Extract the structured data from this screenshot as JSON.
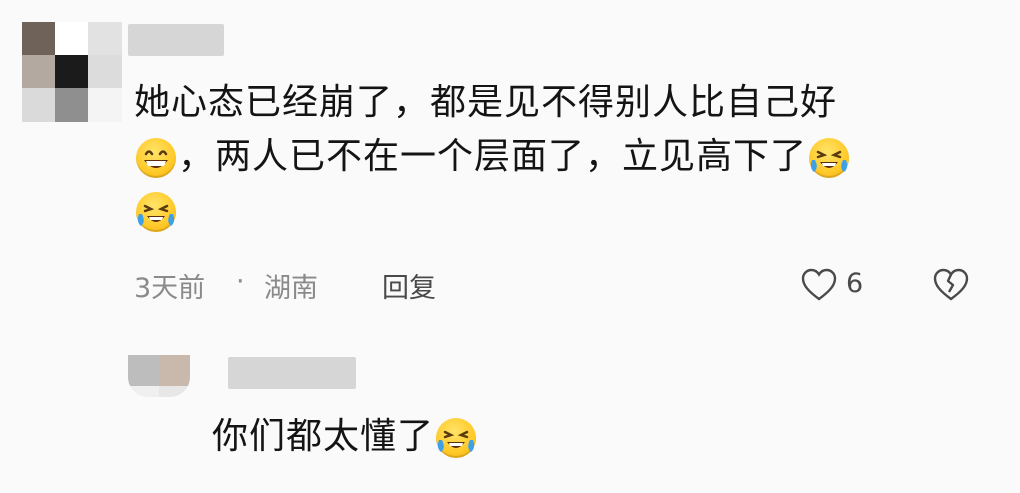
{
  "comment": {
    "lines": [
      "她心态已经崩了，都是见不得别人比自己好",
      "，两人已不在一个层面了，立见高下了"
    ],
    "emojis": [
      "grin-emoji",
      "rofl-emoji",
      "rofl-emoji"
    ],
    "time": "3天前",
    "separator": "·",
    "location": "湖南",
    "reply_label": "回复",
    "like_count": "6"
  },
  "reply": {
    "text": "你们都太懂了",
    "emoji": "rofl-emoji"
  },
  "icons": [
    "heart-icon",
    "broken-heart-icon"
  ],
  "colors": {
    "text": "#141414",
    "meta": "#8a8a8a",
    "emoji_yellow": "#ffc928",
    "tear_blue": "#3ea1e8"
  }
}
